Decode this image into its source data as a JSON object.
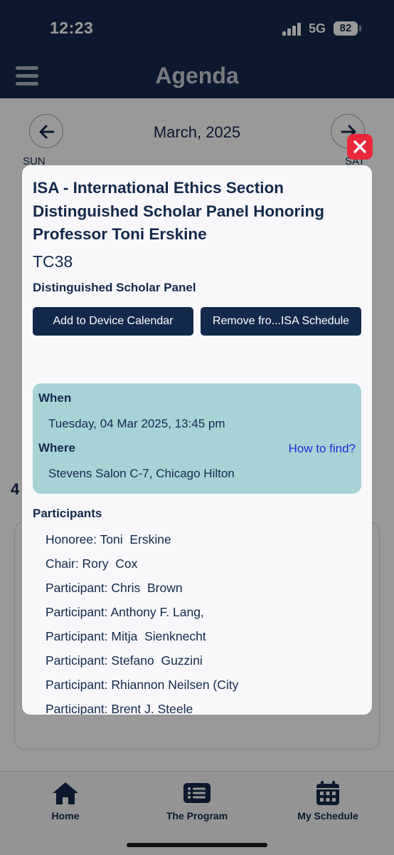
{
  "status_bar": {
    "time": "12:23",
    "network": "5G",
    "battery": "82"
  },
  "header": {
    "title": "Agenda",
    "menu_icon": "hamburger-icon"
  },
  "calendar": {
    "month": "March, 2025",
    "prev_icon": "arrow-left-icon",
    "next_icon": "arrow-right-icon",
    "day_first": "SUN",
    "day_last": "SAT",
    "date_number": "4"
  },
  "modal": {
    "close_icon": "close-icon",
    "title": "ISA - International Ethics Section Distinguished Scholar Panel Honoring Professor Toni Erskine",
    "code": "TC38",
    "session_type": "Distinguished Scholar Panel",
    "buttons": {
      "add_calendar": "Add to Device Calendar",
      "remove_schedule": "Remove fro...ISA Schedule"
    },
    "info": {
      "when_label": "When",
      "when_value": "Tuesday, 04 Mar 2025, 13:45 pm",
      "where_label": "Where",
      "how_to_find": "How to find?",
      "where_value": "Stevens Salon C-7, Chicago Hilton"
    },
    "participants_heading": "Participants",
    "participants": [
      "Honoree: Toni  Erskine",
      "Chair: Rory  Cox",
      "Participant: Chris  Brown",
      "Participant: Anthony F. Lang,",
      "Participant: Mitja  Sienknecht",
      "Participant: Stefano  Guzzini",
      "Participant: Rhiannon Neilsen (City",
      "Participant: Brent J. Steele"
    ]
  },
  "tab_bar": {
    "tabs": [
      {
        "label": "Home",
        "icon": "home-icon"
      },
      {
        "label": "The Program",
        "icon": "list-icon"
      },
      {
        "label": "My Schedule",
        "icon": "calendar-icon"
      }
    ]
  },
  "colors": {
    "navy": "#13294b",
    "info_box": "#a8d3d6",
    "close_red": "#e8283a",
    "link_blue": "#1a2fd8"
  }
}
